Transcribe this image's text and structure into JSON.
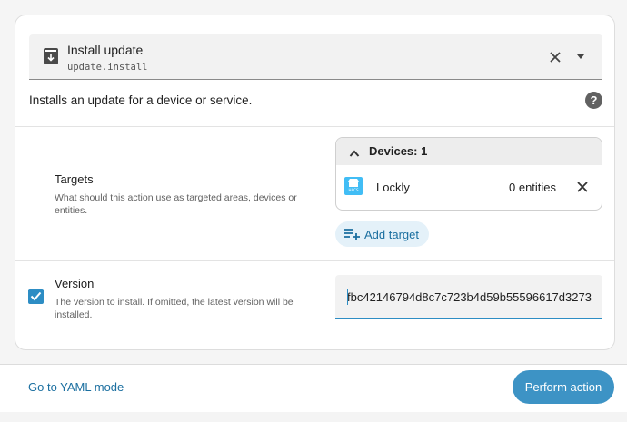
{
  "service": {
    "title": "Install update",
    "id": "update.install",
    "description": "Installs an update for a device or service."
  },
  "targets": {
    "label": "Targets",
    "description": "What should this action use as targeted areas, devices or entities.",
    "devices_header": "Devices: 1",
    "device": {
      "icon_text": "HACS",
      "name": "Lockly",
      "entities": "0 entities"
    },
    "add_label": "Add target"
  },
  "version": {
    "label": "Version",
    "description": "The version to install. If omitted, the latest version will be installed.",
    "value": "fbc42146794d8c7c723b4d59b55596617d3273",
    "enabled": true
  },
  "footer": {
    "yaml_link": "Go to YAML mode",
    "perform_label": "Perform action"
  },
  "colors": {
    "accent": "#2d8dc4",
    "primary_button": "#3d93c5",
    "link": "#1b6fa0"
  },
  "icons": [
    "update-icon",
    "clear-icon",
    "dropdown-arrow-icon",
    "help-icon",
    "chevron-up-icon",
    "hacs-icon",
    "remove-icon",
    "add-target-icon",
    "checkbox-checked-icon"
  ]
}
